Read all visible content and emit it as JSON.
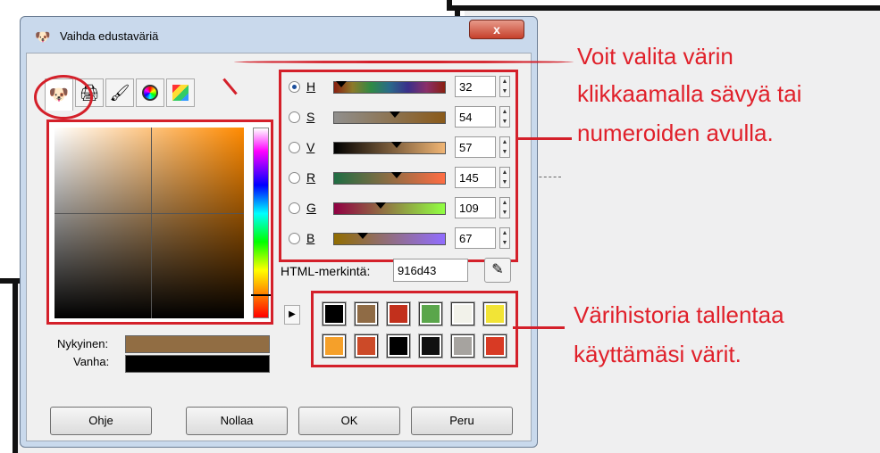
{
  "window": {
    "title": "Vaihda edustaväriä",
    "close_label": "x"
  },
  "sliders": [
    {
      "label": "H",
      "value": "32",
      "checked": true
    },
    {
      "label": "S",
      "value": "54",
      "checked": false
    },
    {
      "label": "V",
      "value": "57",
      "checked": false
    },
    {
      "label": "R",
      "value": "145",
      "checked": false
    },
    {
      "label": "G",
      "value": "109",
      "checked": false
    },
    {
      "label": "B",
      "value": "67",
      "checked": false
    }
  ],
  "html": {
    "label": "HTML-merkintä:",
    "value": "916d43"
  },
  "current": {
    "label": "Nykyinen:",
    "color": "#916d43"
  },
  "old": {
    "label": "Vanha:",
    "color": "#000000"
  },
  "history_colors": [
    "#000000",
    "#8f6b45",
    "#c2301c",
    "#5aa64b",
    "#f2f2ea",
    "#f2e436",
    "#f5a02a",
    "#cc4a28",
    "#000000",
    "#111111",
    "#a6a39f",
    "#d83a24"
  ],
  "buttons": {
    "help": "Ohje",
    "reset": "Nollaa",
    "ok": "OK",
    "cancel": "Peru"
  },
  "annotations": {
    "top_line1": "Voit valita värin",
    "top_line2": "klikkaamalla sävyä tai",
    "top_line3": "numeroiden avulla.",
    "bottom_line1": "Värihistoria tallentaa",
    "bottom_line2": "käyttämäsi värit."
  }
}
